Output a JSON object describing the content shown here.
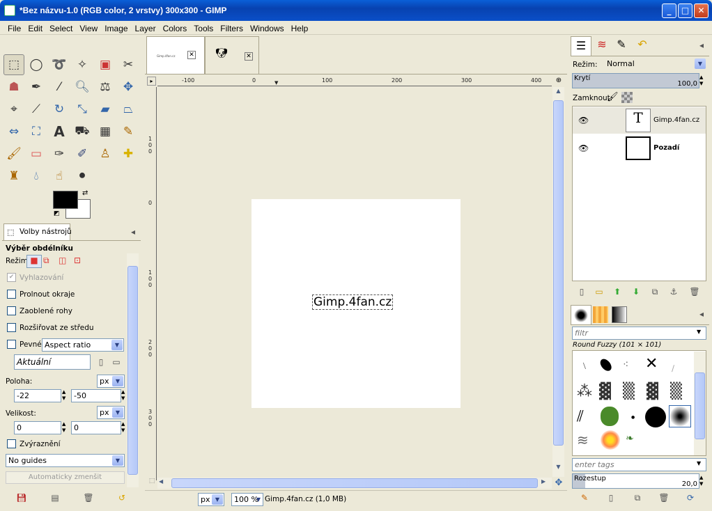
{
  "window": {
    "title": "*Bez názvu-1.0 (RGB color, 2 vrstvy) 300x300 - GIMP",
    "min": "_",
    "max": "□",
    "close": "✕"
  },
  "menu": [
    "File",
    "Edit",
    "Select",
    "View",
    "Image",
    "Layer",
    "Colors",
    "Tools",
    "Filters",
    "Windows",
    "Help"
  ],
  "tool_options": {
    "tab_label": "Volby nástrojů",
    "title": "Výběr obdélníku",
    "mode_label": "Režim:",
    "antialias": "Vyhlazování",
    "feather": "Prolnout okraje",
    "rounded": "Zaoblené rohy",
    "expand_center": "Rozšiřovat ze středu",
    "fixed": "Pevné:",
    "fixed_value": "Aspect ratio",
    "current": "Aktuální",
    "position_label": "Poloha:",
    "position_unit": "px",
    "pos_x": "-22",
    "pos_y": "-50",
    "size_label": "Velikost:",
    "size_unit": "px",
    "size_w": "0",
    "size_h": "0",
    "highlight": "Zvýraznění",
    "guides": "No guides",
    "auto_shrink": "Automaticky zmenšit"
  },
  "image_tabs": [
    {
      "label": "Gimp.4fan.cz"
    },
    {
      "label": ""
    }
  ],
  "ruler": {
    "h": [
      "-100",
      "0",
      "100",
      "200",
      "300",
      "400"
    ],
    "v": [
      "1\n0\n0",
      "0",
      "1\n0\n0",
      "2\n0\n0",
      "3\n0\n0"
    ]
  },
  "canvas": {
    "text": "Gimp.4fan.cz"
  },
  "statusbar": {
    "unit": "px",
    "zoom": "100 %",
    "info": "Gimp.4fan.cz (1,0 MB)"
  },
  "layers": {
    "mode_label": "Režim:",
    "mode_value": "Normal",
    "opacity_label": "Krytí",
    "opacity_value": "100,0",
    "lock_label": "Zamknout:",
    "items": [
      {
        "name": "Gimp.4fan.cz"
      },
      {
        "name": "Pozadí"
      }
    ]
  },
  "brushes": {
    "filter_placeholder": "filtr",
    "current": "Round Fuzzy (101 × 101)",
    "tags_placeholder": "enter tags",
    "spacing_label": "Rozestup",
    "spacing_value": "20,0"
  },
  "colors": {
    "titlebar": "#0842b0",
    "fg": "#000000",
    "bg": "#ffffff",
    "canvas_bg": "#ece9d8"
  }
}
